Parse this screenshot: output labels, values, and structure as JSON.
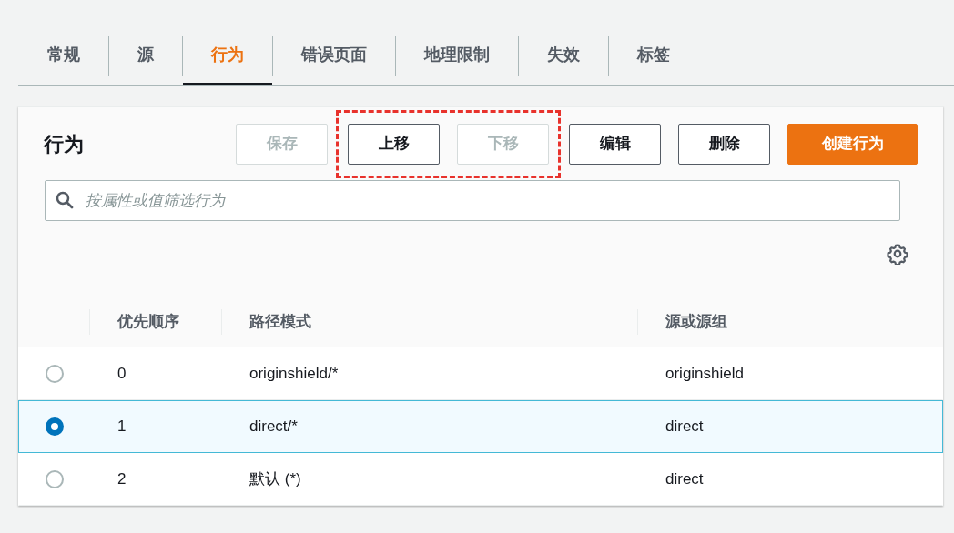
{
  "tabs": [
    {
      "label": "常规",
      "selected": false
    },
    {
      "label": "源",
      "selected": false
    },
    {
      "label": "行为",
      "selected": true
    },
    {
      "label": "错误页面",
      "selected": false
    },
    {
      "label": "地理限制",
      "selected": false
    },
    {
      "label": "失效",
      "selected": false
    },
    {
      "label": "标签",
      "selected": false
    }
  ],
  "panel": {
    "title": "行为",
    "actions": [
      {
        "kind": "button",
        "label": "保存",
        "disabled": true
      },
      {
        "kind": "highlight",
        "buttons": [
          {
            "label": "上移",
            "disabled": false
          },
          {
            "label": "下移",
            "disabled": true
          }
        ]
      },
      {
        "kind": "button",
        "label": "编辑",
        "disabled": false
      },
      {
        "kind": "button",
        "label": "删除",
        "disabled": false
      },
      {
        "kind": "primary",
        "label": "创建行为"
      }
    ],
    "search": {
      "placeholder": "按属性或值筛选行为"
    },
    "table": {
      "columns": [
        "优先顺序",
        "路径模式",
        "源或源组"
      ],
      "rows": [
        {
          "selected": false,
          "cells": [
            "0",
            "originshield/*",
            "originshield"
          ]
        },
        {
          "selected": true,
          "cells": [
            "1",
            "direct/*",
            "direct"
          ]
        },
        {
          "selected": false,
          "cells": [
            "2",
            "默认 (*)",
            "direct"
          ]
        }
      ]
    }
  }
}
